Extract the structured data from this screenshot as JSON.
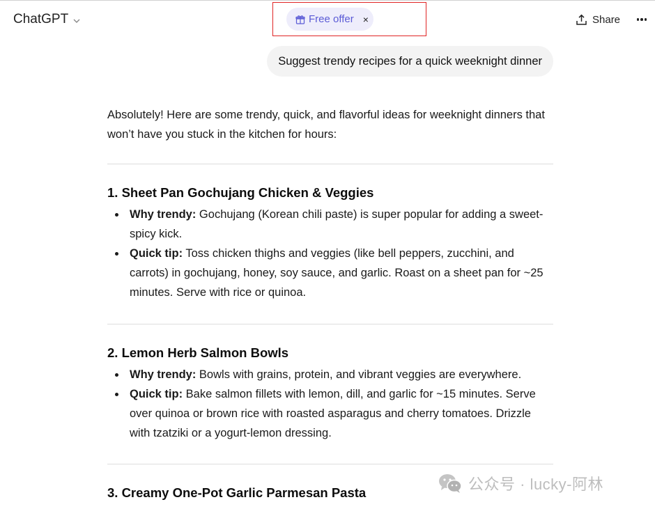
{
  "header": {
    "model_name": "ChatGPT",
    "offer_label": "Free offer",
    "offer_close": "×",
    "share_label": "Share"
  },
  "colors": {
    "offer_accent": "#5b5bd6",
    "offer_bg": "#eeedfb",
    "highlight_box": "#e02424"
  },
  "user_message": "Suggest trendy recipes for a quick weeknight dinner",
  "answer": {
    "intro": "Absolutely! Here are some trendy, quick, and flavorful ideas for weeknight dinners that won’t have you stuck in the kitchen for hours:",
    "sections": [
      {
        "title": "1. Sheet Pan Gochujang Chicken & Veggies",
        "bullets": [
          {
            "label": "Why trendy:",
            "text": " Gochujang (Korean chili paste) is super popular for adding a sweet-spicy kick."
          },
          {
            "label": "Quick tip:",
            "text": " Toss chicken thighs and veggies (like bell peppers, zucchini, and carrots) in gochujang, honey, soy sauce, and garlic. Roast on a sheet pan for ~25 minutes. Serve with rice or quinoa."
          }
        ]
      },
      {
        "title": "2. Lemon Herb Salmon Bowls",
        "bullets": [
          {
            "label": "Why trendy:",
            "text": " Bowls with grains, protein, and vibrant veggies are everywhere."
          },
          {
            "label": "Quick tip:",
            "text": " Bake salmon fillets with lemon, dill, and garlic for ~15 minutes. Serve over quinoa or brown rice with roasted asparagus and cherry tomatoes. Drizzle with tzatziki or a yogurt-lemon dressing."
          }
        ]
      },
      {
        "title": "3. Creamy One-Pot Garlic Parmesan Pasta"
      }
    ]
  },
  "watermark": {
    "text": "公众号 · lucky-阿林",
    "icon": "wechat-icon"
  }
}
